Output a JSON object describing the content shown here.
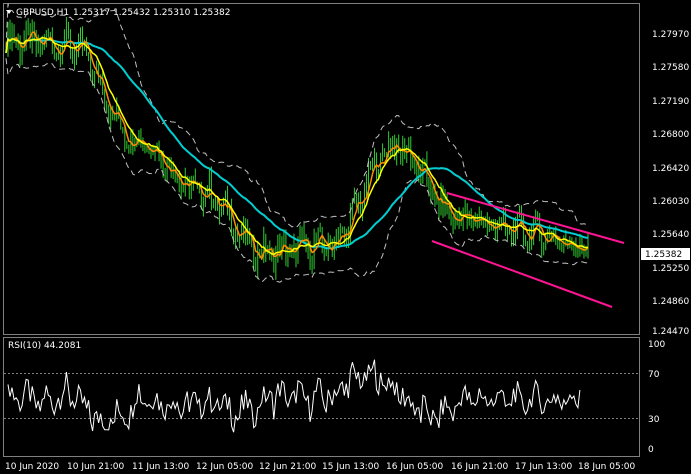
{
  "header": {
    "symbol": "GBPUSD,H1",
    "ohlc": "1.25317 1.25432 1.25310 1.25382"
  },
  "price_axis": {
    "labels": [
      "1.27970",
      "1.27580",
      "1.27190",
      "1.26800",
      "1.26420",
      "1.26030",
      "1.25640",
      "1.25250",
      "1.24860",
      "1.24470"
    ],
    "current_price": "1.25382"
  },
  "rsi": {
    "title": "RSI(10) 44.2081",
    "axis_labels": [
      "100",
      "70",
      "30",
      "0"
    ],
    "levels": [
      70,
      30
    ]
  },
  "time_axis": {
    "labels": [
      "10 Jun 2020",
      "10 Jun 21:00",
      "11 Jun 13:00",
      "12 Jun 05:00",
      "12 Jun 21:00",
      "15 Jun 13:00",
      "16 Jun 05:00",
      "16 Jun 21:00",
      "17 Jun 13:00",
      "18 Jun 05:00"
    ]
  },
  "colors": {
    "background": "#000000",
    "candles": "#32CD32",
    "ma_fast": "#FF8C00",
    "ma_mid": "#FFFF00",
    "ma_slow": "#00CED1",
    "envelope": "#C0C0C0",
    "trendline": "#FF1493",
    "rsi_line": "#FFFFFF",
    "grid": "#808080"
  },
  "chart_data": {
    "type": "line",
    "series": [
      {
        "x": [
          "10 Jun 2020",
          "10 Jun 21:00",
          "11 Jun 13:00",
          "12 Jun 05:00",
          "12 Jun 21:00",
          "15 Jun 13:00",
          "16 Jun 05:00",
          "16 Jun 21:00",
          "17 Jun 13:00",
          "18 Jun 05:00"
        ],
        "values": [
          1.277,
          1.2765,
          1.266,
          1.26,
          1.253,
          1.254,
          1.265,
          1.257,
          1.2555,
          1.2538
        ]
      }
    ],
    "ylim": [
      1.244,
      1.281
    ]
  }
}
